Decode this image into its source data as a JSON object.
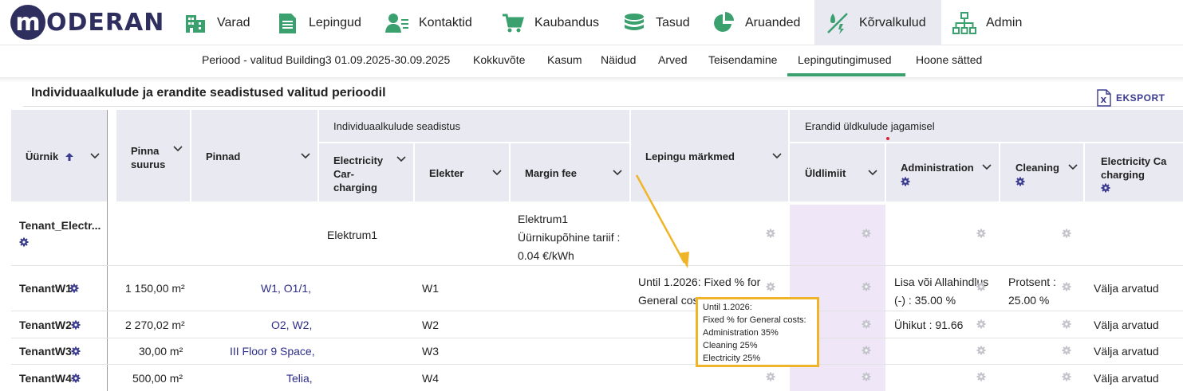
{
  "app": {
    "logo": "MODERAN",
    "logo_letter": "m"
  },
  "nav": {
    "items": [
      {
        "label": "Varad",
        "icon": "building-icon"
      },
      {
        "label": "Lepingud",
        "icon": "document-icon"
      },
      {
        "label": "Kontaktid",
        "icon": "contacts-icon"
      },
      {
        "label": "Kaubandus",
        "icon": "cart-icon"
      },
      {
        "label": "Tasud",
        "icon": "coins-icon"
      },
      {
        "label": "Aruanded",
        "icon": "pie-chart-icon"
      },
      {
        "label": "Kõrvalkulud",
        "icon": "utility-icon",
        "active": true
      },
      {
        "label": "Admin",
        "icon": "org-chart-icon"
      }
    ]
  },
  "subnav": {
    "period": "Periood - valitud Building3 01.09.2025-30.09.2025",
    "items": [
      "Kokkuvõte",
      "Kasum",
      "Näidud",
      "Arved",
      "Teisendamine",
      "Lepingutingimused",
      "Hoone sätted"
    ],
    "active": "Lepingutingimused"
  },
  "section": {
    "title": "Individuaalkulude ja erandite seadistused valitud perioodil",
    "export_label": "EKSPORT"
  },
  "table": {
    "group_headers": {
      "individual": "Individuaalkulude seadistus",
      "exceptions": "Erandid üldkulude jagamisel"
    },
    "columns": {
      "tenant": "Üürnik",
      "area_size_1": "Pinna",
      "area_size_2": "suurus",
      "areas": "Pinnad",
      "ecc_1": "Electricity",
      "ecc_2": "Car-",
      "ecc_3": "charging",
      "elekter": "Elekter",
      "margin": "Margin fee",
      "notes": "Lepingu märkmed",
      "yldlimiit": "Üldlimiit",
      "administration": "Administration",
      "cleaning": "Cleaning",
      "ecc2_1": "Electricity Ca",
      "ecc2_2": "charging"
    },
    "rows": [
      {
        "tenant": "Tenant_Electr...",
        "area_size": "",
        "areas": "",
        "ecc": "Elektrum1",
        "elekter": "",
        "margin_1": "Elektrum1",
        "margin_2": "Üürnikupõhine tariif :",
        "margin_3": "0.04 €/kWh",
        "notes": "",
        "admin": "",
        "cleaning": "",
        "ecc2": ""
      },
      {
        "tenant": "TenantW1",
        "area_size": "1 150,00 m²",
        "areas": "W1, O1/1,",
        "ecc": "",
        "elekter": "W1",
        "notes_1": "Until 1.2026: Fixed % for",
        "notes_2": "General costs:",
        "admin_1": "Lisa või Allahindlus",
        "admin_2": "(-) : 35.00 %",
        "cleaning_1": "Protsent :",
        "cleaning_2": "25.00 %",
        "ecc2": "Välja arvatud"
      },
      {
        "tenant": "TenantW2",
        "area_size": "2 270,02 m²",
        "areas": "O2, W2,",
        "elekter": "W2",
        "admin": "Ühikut : 91.66",
        "ecc2": "Välja arvatud"
      },
      {
        "tenant": "TenantW3",
        "area_size": "30,00 m²",
        "areas": "III Floor 9 Space,",
        "elekter": "W3",
        "ecc2": "Välja arvatud"
      },
      {
        "tenant": "TenantW4",
        "area_size": "500,00 m²",
        "areas": "Telia,",
        "elekter": "W4",
        "ecc2": "Välja arvatud"
      }
    ]
  },
  "tooltip": {
    "lines": [
      "Until 1.2026:",
      "Fixed % for General costs:",
      "Administration 35%",
      "Cleaning 25%",
      "Electricity 25%"
    ]
  },
  "colors": {
    "accent": "#3aa06e",
    "brand": "#2f2f5f",
    "header_bg": "#e9e9f1",
    "highlight_col": "#efe7f7",
    "tooltip_border": "#f0b429",
    "link": "#2d2d8c"
  }
}
